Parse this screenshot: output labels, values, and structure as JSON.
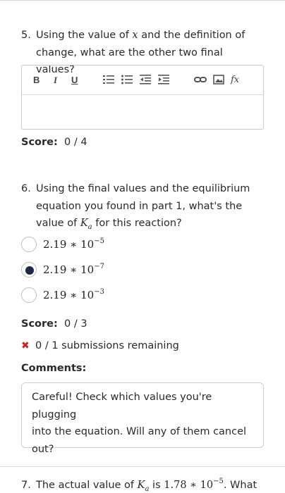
{
  "q5": {
    "number": "5.",
    "line1_a": "Using the value of ",
    "var_x": "x",
    "line1_b": " and the definition of",
    "line2": "change, what are the other two final values?"
  },
  "editor": {
    "bold": "B",
    "italic": "I",
    "underline": "U",
    "icons": [
      "ordered-list-icon",
      "unordered-list-icon",
      "outdent-icon",
      "indent-icon",
      "link-icon",
      "image-icon",
      "formula-icon"
    ],
    "formula_label": "fx"
  },
  "score5": {
    "label": "Score:",
    "value": "0 / 4"
  },
  "q6": {
    "number": "6.",
    "line1": "Using the final values and the equilibrium",
    "line2": "equation you found in part 1, what's the",
    "line3_a": "value of ",
    "k": "K",
    "k_sub": "a",
    "line3_b": " for this reaction?",
    "options": [
      {
        "base": "2.19 ∗ 10",
        "exp": "−5",
        "selected": false
      },
      {
        "base": "2.19 ∗ 10",
        "exp": "−7",
        "selected": true
      },
      {
        "base": "2.19 ∗ 10",
        "exp": "−3",
        "selected": false
      }
    ]
  },
  "score6": {
    "label": "Score:",
    "value": "0 / 3"
  },
  "remaining": "0 / 1 submissions remaining",
  "comments": {
    "label": "Comments:",
    "line1": "Careful! Check which values you're plugging",
    "line2": "into the equation. Will any of them cancel",
    "line3": "out?"
  },
  "q7": {
    "number": "7.",
    "text_a": "The actual value of ",
    "k": "K",
    "k_sub": "a",
    "text_b": " is ",
    "value": "1.78 ∗ 10",
    "exp": "−5",
    "text_c": ". What"
  },
  "colors": {
    "accent_radio": "#1c2a44",
    "error_x": "#cc2222",
    "border": "#c9c9c9"
  }
}
